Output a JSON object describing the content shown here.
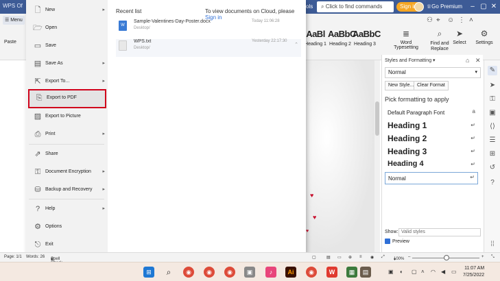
{
  "titlebar": {
    "app_tab": "WPS Of",
    "ribbon_tab_fragment": "ols",
    "quick_search": "Click to find commands",
    "sign_in_label": "Sign in",
    "premium_label": "Go Premium"
  },
  "ribbon": {
    "menu_label": "Menu",
    "paste_label": "Paste",
    "styles": [
      {
        "preview": "AaBl",
        "name": "Heading 1"
      },
      {
        "preview": "AaBbC",
        "name": "Heading 2"
      },
      {
        "preview": "AaBbC",
        "name": "Heading 3"
      }
    ],
    "tools": {
      "word_typesetting": "Word Typesetting",
      "find_replace": "Find and\nReplace",
      "select": "Select",
      "settings": "Settings"
    }
  },
  "file_menu": {
    "items": [
      {
        "label": "New",
        "icon": "new-doc-icon",
        "arrow": true
      },
      {
        "label": "Open",
        "icon": "open-folder-icon",
        "arrow": false
      },
      {
        "label": "Save",
        "icon": "save-icon",
        "arrow": false
      },
      {
        "label": "Save As",
        "icon": "save-as-icon",
        "arrow": true
      },
      {
        "label": "Export To...",
        "icon": "export-icon",
        "arrow": true
      },
      {
        "label": "Export to PDF",
        "icon": "pdf-icon",
        "arrow": false,
        "highlighted": true
      },
      {
        "label": "Export to Picture",
        "icon": "picture-icon",
        "arrow": false
      },
      {
        "label": "Print",
        "icon": "print-icon",
        "arrow": true
      },
      {
        "label": "Share",
        "icon": "share-icon",
        "arrow": false
      },
      {
        "label": "Document Encryption",
        "icon": "lock-icon",
        "arrow": true
      },
      {
        "label": "Backup and Recovery",
        "icon": "backup-icon",
        "arrow": true
      },
      {
        "label": "Help",
        "icon": "help-icon",
        "arrow": true
      },
      {
        "label": "Options",
        "icon": "gear-icon",
        "arrow": false
      },
      {
        "label": "Exit",
        "icon": "exit-icon",
        "arrow": false
      }
    ],
    "recent_title": "Recent list",
    "cloud_note": "To view documents on Cloud, please",
    "cloud_link": "Sign in",
    "recent_files": [
      {
        "name": "Sample-Valentines-Day-Poster.docx",
        "path": "Desktop/",
        "time": "Today 11:06:28"
      },
      {
        "name": "WPS.txt",
        "path": "Desktop/",
        "time": "Yesterday 22:17:30"
      }
    ]
  },
  "styles_pane": {
    "title": "Styles and Formatting",
    "current_style": "Normal",
    "new_style_button": "New Style...",
    "clear_format_button": "Clear Format",
    "pick_label": "Pick formatting to apply",
    "styles": [
      {
        "name": "Default Paragraph Font",
        "mark": "a"
      },
      {
        "name": "Heading 1",
        "mark": "↵"
      },
      {
        "name": "Heading 2",
        "mark": "↵"
      },
      {
        "name": "Heading 3",
        "mark": "↵"
      },
      {
        "name": "Heading 4",
        "mark": "↵"
      },
      {
        "name": "Normal",
        "mark": "↵"
      }
    ],
    "show_label": "Show:",
    "show_value": "Valid styles",
    "preview_label": "Preview"
  },
  "statusbar": {
    "page": "Page: 1/1",
    "words": "Words: 26",
    "spell_check": "Spell Check",
    "zoom": "100%"
  },
  "taskbar": {
    "time": "11:07 AM",
    "date": "7/25/2022"
  }
}
